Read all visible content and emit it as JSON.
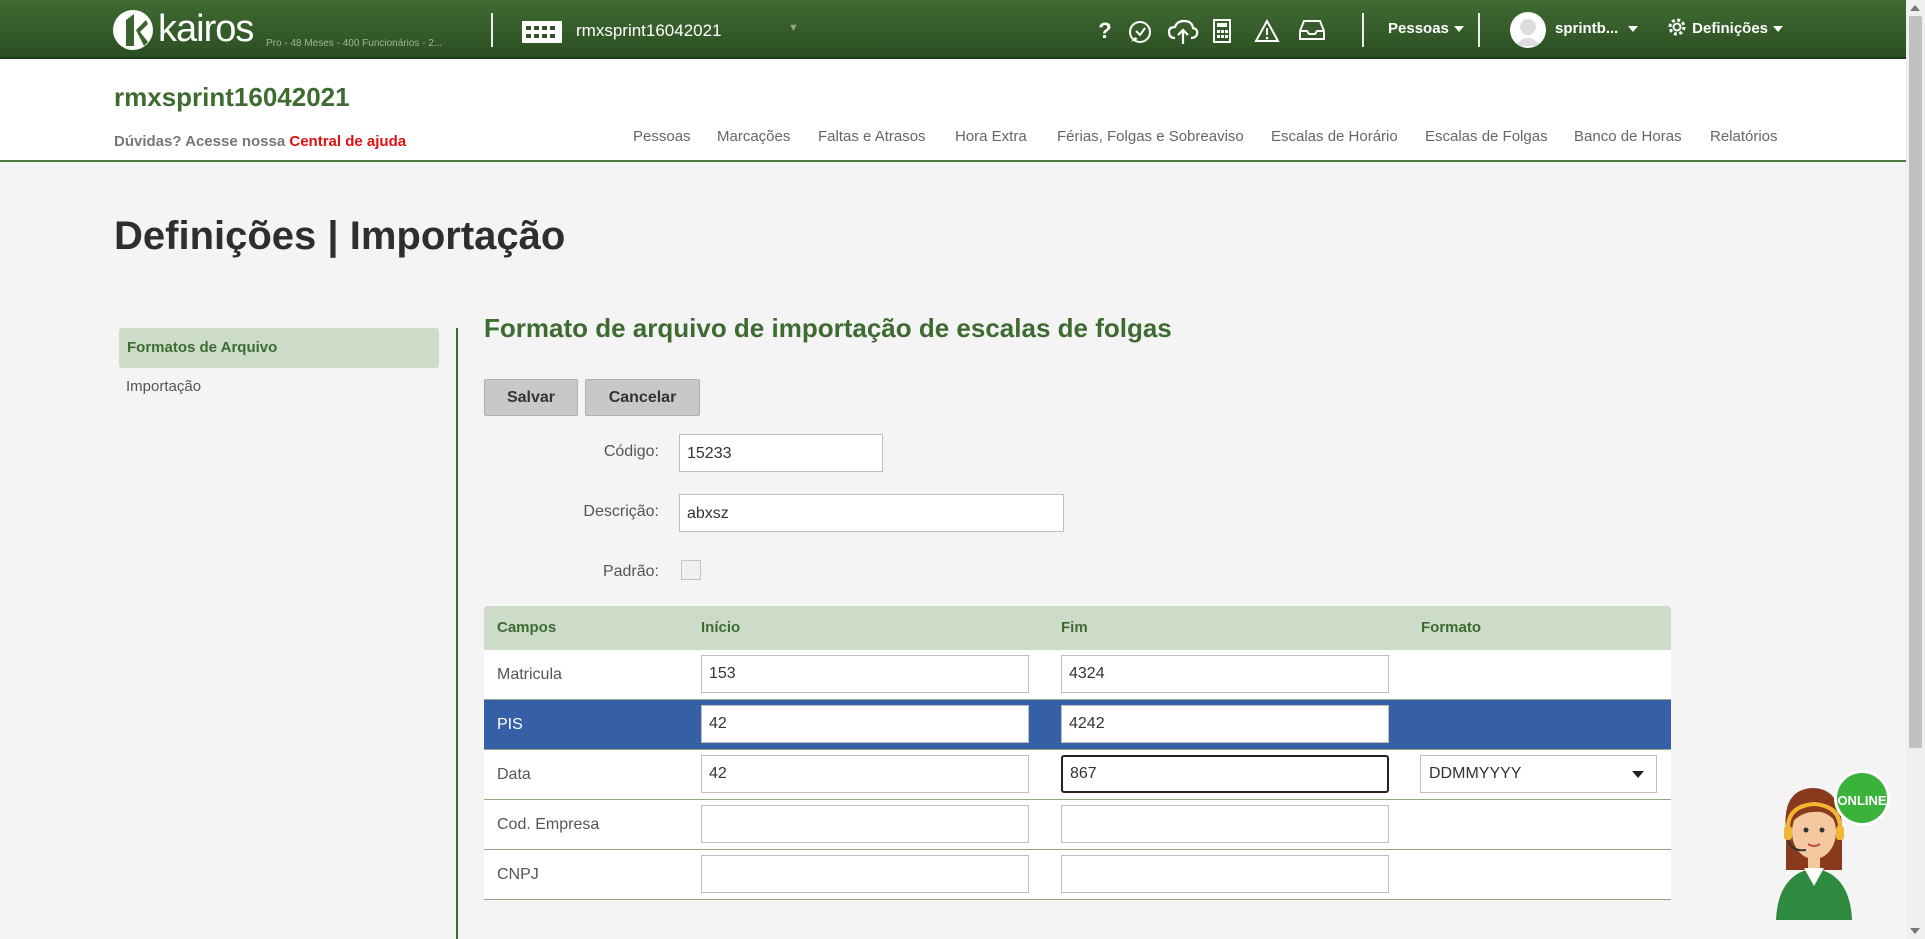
{
  "topbar": {
    "logo_text": "kairos",
    "plan_text": "Pro - 48 Meses - 400 Funcionários - 2...",
    "company": "rmxsprint16042021",
    "help_icon": "question-icon",
    "support_icon": "support-icon",
    "cloud_icon": "cloud-upload-icon",
    "calculator_icon": "calculator-icon",
    "warning_icon": "warning-icon",
    "inbox_icon": "inbox-icon",
    "pessoas_label": "Pessoas",
    "user_label": "sprintb...",
    "settings_label": "Definições"
  },
  "header": {
    "title": "rmxsprint16042021",
    "help_prefix": "Dúvidas? Acesse nossa",
    "help_link": "Central de ajuda",
    "nav": [
      "Pessoas",
      "Marcações",
      "Faltas e Atrasos",
      "Hora Extra",
      "Férias, Folgas e Sobreaviso",
      "Escalas de Horário",
      "Escalas de Folgas",
      "Banco de Horas",
      "Relatórios"
    ]
  },
  "page": {
    "title": "Definições | Importação"
  },
  "sidebar": {
    "items": [
      "Formatos de Arquivo",
      "Importação"
    ]
  },
  "form": {
    "title": "Formato de arquivo de importação de escalas de folgas",
    "save_label": "Salvar",
    "cancel_label": "Cancelar",
    "codigo_label": "Código:",
    "codigo_value": "15233",
    "descricao_label": "Descrição:",
    "descricao_value": "abxsz",
    "padrao_label": "Padrão:"
  },
  "table": {
    "headers": [
      "Campos",
      "Início",
      "Fim",
      "Formato"
    ],
    "rows": [
      {
        "campo": "Matricula",
        "inicio": "153",
        "fim": "4324",
        "formato": ""
      },
      {
        "campo": "PIS",
        "inicio": "42",
        "fim": "4242",
        "formato": ""
      },
      {
        "campo": "Data",
        "inicio": "42",
        "fim": "867",
        "formato": "DDMMYYYY"
      },
      {
        "campo": "Cod. Empresa",
        "inicio": "",
        "fim": "",
        "formato": ""
      },
      {
        "campo": "CNPJ",
        "inicio": "",
        "fim": "",
        "formato": ""
      }
    ]
  },
  "chat": {
    "status": "ONLINE"
  },
  "colors": {
    "brand_green": "#3e6b31",
    "selected_row": "#3560a8",
    "help_link": "#e01010"
  }
}
